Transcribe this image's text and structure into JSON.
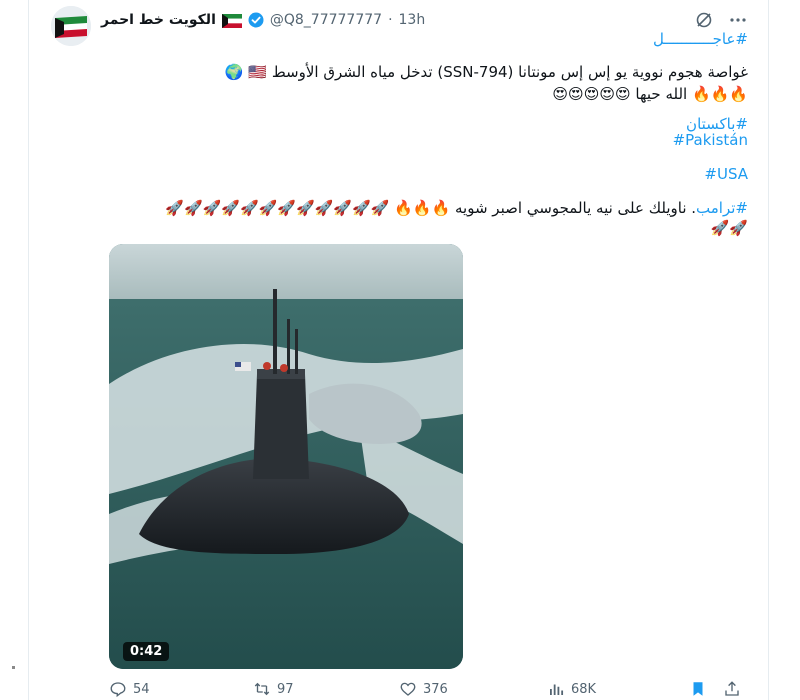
{
  "header": {
    "display_name": "الكويت خط احمر",
    "flag_icon": "kuwait-flag-icon",
    "verified_icon": "verified-badge-icon",
    "handle": "@Q8_77777777",
    "separator": "·",
    "time": "13h",
    "menu_icons": [
      "grok-icon",
      "more-icon"
    ]
  },
  "tweet": {
    "hashtag_urgent": "#عاجـــــــــــل",
    "line_main": "غواصة هجوم نووية يو إس إس مونتانا (SSN-794) تدخل مياه الشرق الأوسط",
    "line_main_emojis": "🇺🇸 🌍",
    "line_praise": "الله حيها",
    "line_praise_emojis_fire": "🔥🔥🔥",
    "line_praise_emojis_love": "😍😍😍😍😍",
    "hashtag_pakistan_ar": "#باكستان",
    "hashtag_pakistan_en": "#Pakistán",
    "hashtag_usa": "#USA",
    "hashtag_trump": "#ترامب",
    "line_trump": ". ناويلك على نيه يالمجوسي اصبر شويه",
    "line_trump_fire": "🔥🔥🔥",
    "line_trump_rockets": "🚀🚀🚀🚀🚀🚀🚀🚀🚀🚀🚀🚀",
    "line_trump_rockets2": "🚀🚀"
  },
  "media": {
    "type": "video",
    "duration": "0:42",
    "description_icon": "submarine-video-thumbnail"
  },
  "actions": {
    "reply_count": "54",
    "retweet_count": "97",
    "like_count": "376",
    "views_count": "68K",
    "icons": [
      "reply-icon",
      "retweet-icon",
      "like-icon",
      "views-icon",
      "bookmark-icon",
      "share-icon"
    ]
  },
  "colors": {
    "accent": "#1d9bf0",
    "text_primary": "#0f1419",
    "text_secondary": "#536471",
    "bookmark": "#1d9bf0"
  }
}
